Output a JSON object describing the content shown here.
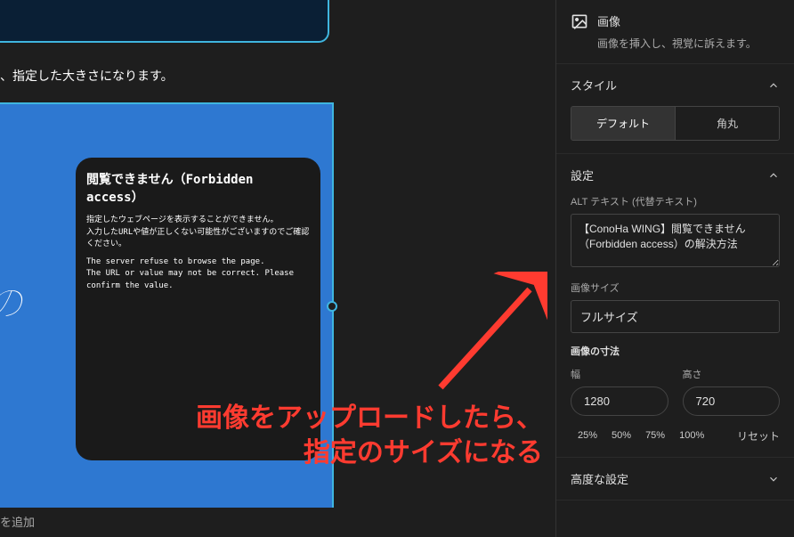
{
  "canvas": {
    "desc_text": "、指定した大きさになります。",
    "side_label_partial": ")の",
    "card": {
      "title": "閲覧できません（Forbidden access）",
      "line1": "指定したウェブページを表示することができません。",
      "line2": "入力したURLや値が正しくない可能性がございますのでご確認ください。",
      "line3": "The server refuse to browse the page.",
      "line4": "The URL or value may not be correct. Please confirm the value."
    },
    "add_label": "を追加"
  },
  "annotation": {
    "line1": "画像をアップロードしたら、",
    "line2": "指定のサイズになる"
  },
  "sidebar": {
    "block_type": "画像",
    "block_desc": "画像を挿入し、視覚に訴えます。",
    "style": {
      "title": "スタイル",
      "option_default": "デフォルト",
      "option_rounded": "角丸"
    },
    "settings": {
      "title": "設定",
      "alt_label": "ALT テキスト (代替テキスト)",
      "alt_value": "【ConoHa WING】閲覧できません（Forbidden access）の解決方法",
      "size_label": "画像サイズ",
      "size_value": "フルサイズ",
      "dimensions_label": "画像の寸法",
      "width_label": "幅",
      "height_label": "高さ",
      "width_value": "1280",
      "height_value": "720",
      "pct_25": "25%",
      "pct_50": "50%",
      "pct_75": "75%",
      "pct_100": "100%",
      "reset_label": "リセット"
    },
    "advanced": {
      "title": "高度な設定"
    }
  }
}
